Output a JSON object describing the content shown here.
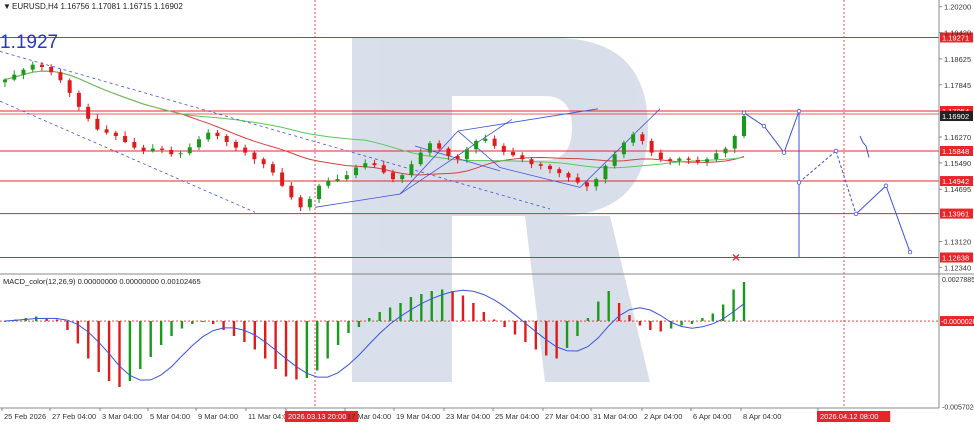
{
  "window": {
    "symbol_line": "EURUSD,H4  1.16756 1.17081 1.16715 1.16902",
    "big_label": "1.1927",
    "indicator_label": "MACD_color(12,26,9) 0.00000000 0.00000000 0.00102465"
  },
  "colors": {
    "bull": "#1a9a1a",
    "bear": "#e01b1b",
    "level": "#e8262a",
    "forecast": "#3b55d8",
    "ma_red": "#d64040",
    "ma_green": "#5ac85a",
    "channel": "#3b55d8",
    "watermark": "#c5cfe0"
  },
  "chart_data": [
    {
      "type": "candlestick",
      "symbol": "EURUSD",
      "timeframe": "H4",
      "ohlc_last": {
        "open": 1.16756,
        "high": 1.17081,
        "low": 1.16715,
        "close": 1.16902
      },
      "y_ticks": [
        "1.20200",
        "1.19420",
        "1.18625",
        "1.17845",
        "1.16270",
        "1.15490",
        "1.14695",
        "1.13120",
        "1.12340"
      ],
      "x_ticks": [
        "25 Feb 2026",
        "27 Feb 04:00",
        "3 Mar 04:00",
        "5 Mar 04:00",
        "9 Mar 04:00",
        "11 Mar 04:00",
        "2026.03.13 20:00",
        "17 Mar 04:00",
        "19 Mar 04:00",
        "23 Mar 04:00",
        "25 Mar 04:00",
        "27 Mar 04:00",
        "31 Mar 04:00",
        "2 Apr 04:00",
        "6 Apr 04:00",
        "8 Apr 04:00",
        "2026.04.12 08:00"
      ],
      "ylim": [
        1.122,
        1.204
      ],
      "levels": [
        {
          "label": "1.19271",
          "value": 1.19271
        },
        {
          "label": "1.17054",
          "value": 1.17054
        },
        {
          "label": "1.16902",
          "value": 1.16902
        },
        {
          "label": "1.15848",
          "value": 1.15848
        },
        {
          "label": "1.14942",
          "value": 1.14942
        },
        {
          "label": "1.13961",
          "value": 1.13961
        },
        {
          "label": "1.12638",
          "value": 1.12638
        }
      ],
      "price_path": [
        1.18,
        1.1815,
        1.183,
        1.1845,
        1.1838,
        1.1822,
        1.1798,
        1.176,
        1.1718,
        1.1682,
        1.165,
        1.164,
        1.163,
        1.1612,
        1.1595,
        1.1585,
        1.1592,
        1.1588,
        1.1575,
        1.1578,
        1.1596,
        1.162,
        1.164,
        1.163,
        1.1612,
        1.1595,
        1.158,
        1.156,
        1.1545,
        1.152,
        1.148,
        1.1445,
        1.1415,
        1.144,
        1.148,
        1.1495,
        1.15,
        1.1512,
        1.1535,
        1.1548,
        1.1542,
        1.152,
        1.15,
        1.1512,
        1.1545,
        1.158,
        1.1608,
        1.1592,
        1.157,
        1.156,
        1.159,
        1.1615,
        1.1622,
        1.16,
        1.1582,
        1.1572,
        1.156,
        1.1545,
        1.154,
        1.153,
        1.1518,
        1.1505,
        1.149,
        1.1478,
        1.15,
        1.154,
        1.1575,
        1.161,
        1.1635,
        1.1615,
        1.158,
        1.156,
        1.1555,
        1.1562,
        1.1558,
        1.1552,
        1.156,
        1.1578,
        1.1592,
        1.163,
        1.169
      ],
      "macd_hist": [
        0.0,
        0.0001,
        0.0002,
        0.0003,
        0.0002,
        0.0001,
        -0.0006,
        -0.0015,
        -0.0025,
        -0.0034,
        -0.004,
        -0.0044,
        -0.004,
        -0.0032,
        -0.0024,
        -0.0016,
        -0.001,
        -0.0005,
        -0.0002,
        0.0,
        -0.0002,
        -0.0006,
        -0.001,
        -0.0014,
        -0.0019,
        -0.0025,
        -0.0032,
        -0.0037,
        -0.0039,
        -0.0038,
        -0.0033,
        -0.0025,
        -0.0016,
        -0.0008,
        -0.0004,
        0.0002,
        0.0006,
        0.0009,
        0.0012,
        0.0016,
        0.0018,
        0.002,
        0.0021,
        0.002,
        0.0017,
        0.0012,
        0.0006,
        0.0001,
        -0.0004,
        -0.0009,
        -0.0014,
        -0.0019,
        -0.0023,
        -0.0025,
        -0.0018,
        -0.001,
        0.0002,
        0.0013,
        0.002,
        0.0012,
        0.0004,
        -0.0003,
        -0.0006,
        -0.0007,
        -0.0005,
        -0.0003,
        -0.0002,
        0.0002,
        0.0005,
        0.0011,
        0.0021,
        0.0026
      ],
      "macd_ylim": [
        -0.0058,
        0.003
      ],
      "macd_ticks": [
        "0.0027885",
        "-0.0000026",
        "-0.0057020"
      ],
      "forecast_path": [
        1.17,
        1.166,
        1.158,
        1.1705,
        1.149,
        1.1585,
        1.1395,
        1.148,
        1.128
      ],
      "target_marker": "x"
    }
  ]
}
